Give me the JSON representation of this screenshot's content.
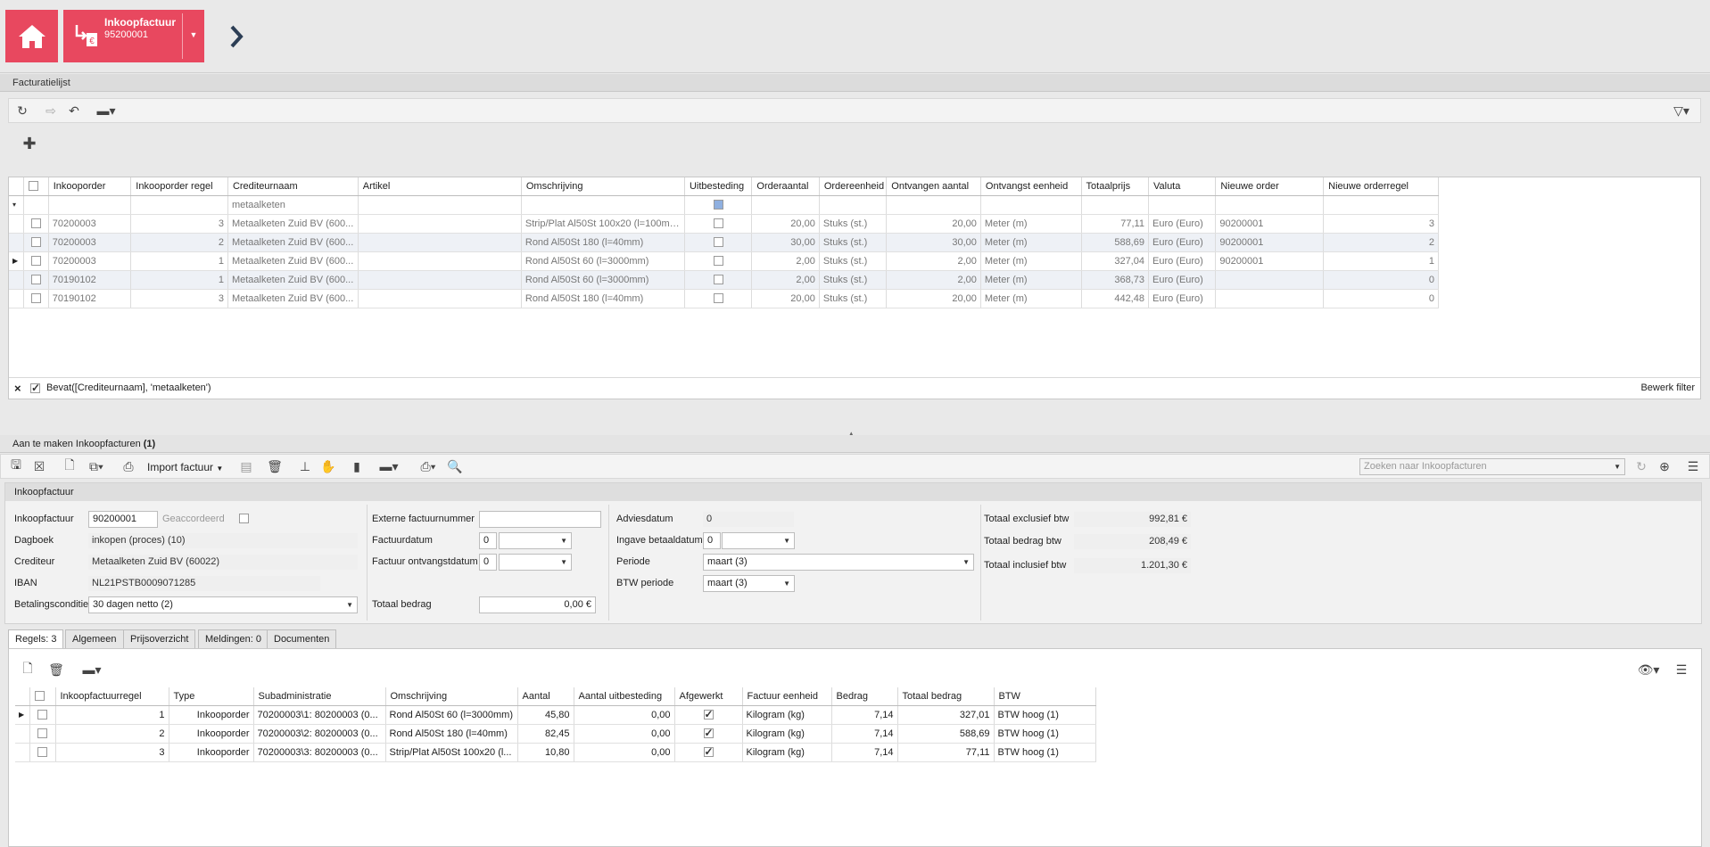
{
  "header": {
    "doc_title": "Inkoopfactuur",
    "doc_number": "95200001"
  },
  "facturatielijst": {
    "title": "Facturatielijst",
    "columns": [
      "Inkooporder",
      "Inkooporder regel",
      "Crediteurnaam",
      "Artikel",
      "Omschrijving",
      "Uitbesteding",
      "Orderaantal",
      "Ordereenheid",
      "Ontvangen aantal",
      "Ontvangst eenheid",
      "Totaalprijs",
      "Valuta",
      "Nieuwe order",
      "Nieuwe orderregel"
    ],
    "filter_value": "metaalketen",
    "rows": [
      [
        "70200003",
        "3",
        "Metaalketen Zuid BV (600...",
        "",
        "Strip/Plat Al50St 100x20 (l=100mm)",
        "",
        "20,00",
        "Stuks (st.)",
        "20,00",
        "Meter (m)",
        "77,11",
        "Euro (Euro)",
        "90200001",
        "3"
      ],
      [
        "70200003",
        "2",
        "Metaalketen Zuid BV (600...",
        "",
        "Rond Al50St 180 (l=40mm)",
        "",
        "30,00",
        "Stuks (st.)",
        "30,00",
        "Meter (m)",
        "588,69",
        "Euro (Euro)",
        "90200001",
        "2"
      ],
      [
        "70200003",
        "1",
        "Metaalketen Zuid BV (600...",
        "",
        "Rond Al50St 60 (l=3000mm)",
        "",
        "2,00",
        "Stuks (st.)",
        "2,00",
        "Meter (m)",
        "327,04",
        "Euro (Euro)",
        "90200001",
        "1"
      ],
      [
        "70190102",
        "1",
        "Metaalketen Zuid BV (600...",
        "",
        "Rond Al50St 60 (l=3000mm)",
        "",
        "2,00",
        "Stuks (st.)",
        "2,00",
        "Meter (m)",
        "368,73",
        "Euro (Euro)",
        "",
        "0"
      ],
      [
        "70190102",
        "3",
        "Metaalketen Zuid BV (600...",
        "",
        "Rond Al50St 180 (l=40mm)",
        "",
        "20,00",
        "Stuks (st.)",
        "20,00",
        "Meter (m)",
        "442,48",
        "Euro (Euro)",
        "",
        "0"
      ]
    ],
    "filter_expression": "Bevat([Crediteurnaam], 'metaalketen')",
    "edit_filter": "Bewerk filter"
  },
  "aan_te_maken": {
    "title_prefix": "Aan te maken Inkoopfacturen ",
    "title_count": "(1)",
    "import_label": "Import factuur",
    "search_placeholder": "Zoeken naar Inkoopfacturen"
  },
  "form": {
    "section_title": "Inkoopfactuur",
    "inkoopfactuur_label": "Inkoopfactuur",
    "inkoopfactuur_value": "90200001",
    "geaccordeerd_label": "Geaccordeerd",
    "dagboek_label": "Dagboek",
    "dagboek_value": "inkopen (proces) (10)",
    "crediteur_label": "Crediteur",
    "crediteur_value": "Metaalketen Zuid BV (60022)",
    "iban_label": "IBAN",
    "iban_value": "NL21PSTB0009071285",
    "betalingsconditie_label": "Betalingsconditie",
    "betalingsconditie_value": "30 dagen netto (2)",
    "externe_label": "Externe factuurnummer",
    "factuurdatum_label": "Factuurdatum",
    "factuurdatum_value": "0",
    "ontvangstdatum_label": "Factuur ontvangstdatum",
    "ontvangstdatum_value": "0",
    "totaal_bedrag_label": "Totaal bedrag",
    "totaal_bedrag_value": "0,00 €",
    "adviesdatum_label": "Adviesdatum",
    "adviesdatum_value": "0",
    "ingave_label": "Ingave betaaldatum",
    "ingave_value": "0",
    "periode_label": "Periode",
    "periode_value": "maart (3)",
    "btw_periode_label": "BTW periode",
    "btw_periode_value": "maart (3)",
    "excl_label": "Totaal exclusief btw",
    "excl_value": "992,81 €",
    "btw_label": "Totaal bedrag btw",
    "btw_value": "208,49 €",
    "incl_label": "Totaal inclusief btw",
    "incl_value": "1.201,30 €"
  },
  "tabs": [
    "Regels: 3",
    "Algemeen",
    "Prijsoverzicht",
    "Meldingen: 0",
    "Documenten"
  ],
  "regels": {
    "columns": [
      "Inkoopfactuurregel",
      "Type",
      "Subadministratie",
      "Omschrijving",
      "Aantal",
      "Aantal uitbesteding",
      "Afgewerkt",
      "Factuur eenheid",
      "Bedrag",
      "Totaal bedrag",
      "BTW"
    ],
    "rows": [
      [
        "1",
        "Inkooporder",
        "70200003\\1: 80200003 (0...",
        "Rond Al50St 60 (l=3000mm)",
        "45,80",
        "0,00",
        "",
        "Kilogram (kg)",
        "7,14",
        "327,01",
        "BTW hoog (1)"
      ],
      [
        "2",
        "Inkooporder",
        "70200003\\2: 80200003 (0...",
        "Rond Al50St 180 (l=40mm)",
        "82,45",
        "0,00",
        "",
        "Kilogram (kg)",
        "7,14",
        "588,69",
        "BTW hoog (1)"
      ],
      [
        "3",
        "Inkooporder",
        "70200003\\3: 80200003 (0...",
        "Strip/Plat Al50St 100x20 (l...",
        "10,80",
        "0,00",
        "",
        "Kilogram (kg)",
        "7,14",
        "77,11",
        "BTW hoog (1)"
      ]
    ]
  }
}
